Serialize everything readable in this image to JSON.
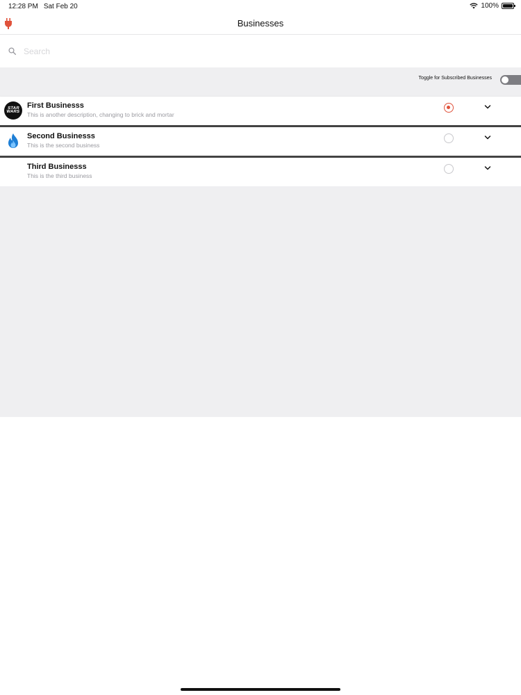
{
  "status_bar": {
    "time": "12:28 PM",
    "date": "Sat Feb 20",
    "battery": "100%",
    "battery_level": 1.0
  },
  "nav": {
    "title": "Businesses",
    "left_icon": "plug-icon",
    "accent_color": "#e0523b"
  },
  "search": {
    "placeholder": "Search",
    "value": ""
  },
  "filter": {
    "toggle_label": "Toggle for Subscribed Businesses",
    "toggle_on": false
  },
  "businesses": [
    {
      "name": "First Businesss",
      "description": "This is another description, changing to brick and mortar",
      "logo": "star-wars-logo",
      "logo_text": "STAR WARS",
      "selected": true
    },
    {
      "name": "Second Businesss",
      "description": "This is the second business",
      "logo": "flame-icon",
      "selected": false
    },
    {
      "name": "Third Businesss",
      "description": "This is the third business",
      "logo": "none",
      "selected": false
    }
  ]
}
